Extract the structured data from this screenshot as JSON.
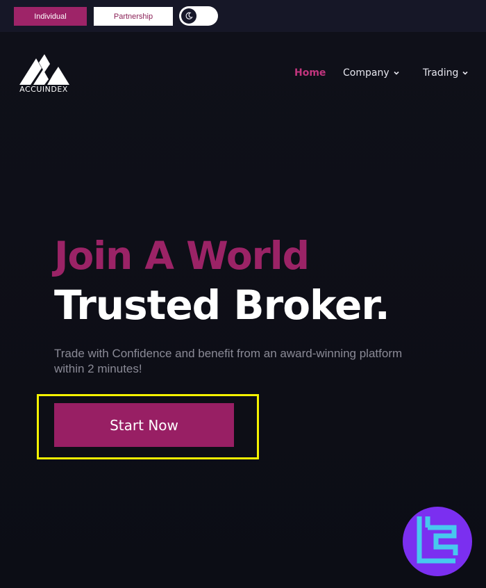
{
  "topbar": {
    "individual_label": "Individual",
    "partnership_label": "Partnership",
    "theme_toggle_icon": "moon-icon"
  },
  "brand": {
    "name": "ACCUINDEX",
    "logo_icon": "accuindex-logo"
  },
  "nav": {
    "items": [
      {
        "label": "Home",
        "active": true
      },
      {
        "label": "Company",
        "has_dropdown": true
      },
      {
        "label": "Trading",
        "has_dropdown": true
      }
    ]
  },
  "hero": {
    "headline_line1": "Join A World",
    "headline_line2": "Trusted Broker.",
    "subtext": "Trade with Confidence and benefit from an award-winning platform within 2 minutes!",
    "cta_label": "Start Now"
  },
  "badge": {
    "icon": "tc-badge-icon"
  },
  "colors": {
    "accent": "#9b2366",
    "background": "#0d0e17",
    "highlight": "#f4f200",
    "badge": "#7b2ff0"
  }
}
